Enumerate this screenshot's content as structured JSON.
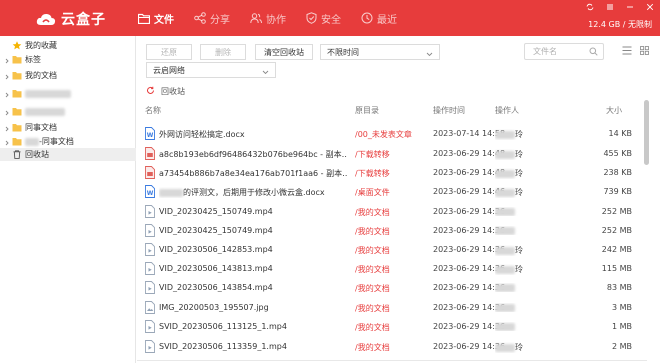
{
  "app": {
    "name": "云盒子"
  },
  "nav": [
    {
      "label": "文件",
      "icon": "folder-icon",
      "active": true
    },
    {
      "label": "分享",
      "icon": "share-icon",
      "active": false
    },
    {
      "label": "协作",
      "icon": "team-icon",
      "active": false
    },
    {
      "label": "安全",
      "icon": "shield-icon",
      "active": false
    },
    {
      "label": "最近",
      "icon": "clock-icon",
      "active": false
    }
  ],
  "quota": "12.4 GB / 无限制",
  "sidebar": {
    "items": [
      {
        "label": "我的收藏",
        "icon": "star-icon",
        "arrow": false,
        "redacted": false
      },
      {
        "label": "标签",
        "icon": "folder-icon",
        "arrow": true,
        "redacted": false
      },
      {
        "label": "我的文档",
        "icon": "folder-icon",
        "arrow": true,
        "redacted": false
      },
      {
        "label": "",
        "icon": "folder-icon",
        "arrow": true,
        "redacted": true
      },
      {
        "label": "",
        "icon": "folder-icon",
        "arrow": true,
        "redacted": true
      },
      {
        "label": "同事文档",
        "icon": "folder-icon",
        "arrow": true,
        "redacted": false
      },
      {
        "label": "-同事文档",
        "icon": "folder-icon",
        "arrow": true,
        "redacted": true
      },
      {
        "label": "回收站",
        "icon": "trash-icon",
        "arrow": false,
        "redacted": false,
        "selected": true
      }
    ]
  },
  "toolbar": {
    "restore_label": "还原",
    "delete_label": "删除",
    "empty_label": "清空回收站",
    "time_filter": "不限时间",
    "scope_filter": "云启网络",
    "search_placeholder": "文件名"
  },
  "breadcrumb": {
    "label": "回收站"
  },
  "table": {
    "headers": {
      "name": "名称",
      "orig": "原目录",
      "time": "操作时间",
      "op": "操作人",
      "size": "大小"
    },
    "rows": [
      {
        "name": "外网访问轻松搞定.docx",
        "icon": "word-doc-icon",
        "orig": "/00_未发表文章",
        "time": "2023-07-14 14:58",
        "op": "玲",
        "size": "14 KB",
        "nameRedacted": false
      },
      {
        "name": "a8c8b193eb6df96486432b076be964bc - 副本…",
        "icon": "red-file-icon",
        "orig": "/下载转移",
        "time": "2023-06-29 14:48",
        "op": "玲",
        "size": "455 KB",
        "nameRedacted": false
      },
      {
        "name": "a73454b886b7a8e34ea176ab701f1aa6 - 副本…",
        "icon": "red-file-icon",
        "orig": "/下载转移",
        "time": "2023-06-29 14:48",
        "op": "玲",
        "size": "238 KB",
        "nameRedacted": false
      },
      {
        "name": "的评测文，后期用于修改小微云盒.docx",
        "icon": "word-doc-icon",
        "orig": "/桌面文件",
        "time": "2023-06-29 14:46",
        "op": "玲",
        "size": "739 KB",
        "nameRedacted": true
      },
      {
        "name": "VID_20230425_150749.mp4",
        "icon": "video-file-icon",
        "orig": "/我的文档",
        "time": "2023-06-29 14:36",
        "op": "",
        "size": "252 MB",
        "nameRedacted": false
      },
      {
        "name": "VID_20230425_150749.mp4",
        "icon": "video-file-icon",
        "orig": "/我的文档",
        "time": "2023-06-29 14:36",
        "op": "",
        "size": "252 MB",
        "nameRedacted": false
      },
      {
        "name": "VID_20230506_142853.mp4",
        "icon": "video-file-icon",
        "orig": "/我的文档",
        "time": "2023-06-29 14:36",
        "op": "玲",
        "size": "242 MB",
        "nameRedacted": false
      },
      {
        "name": "VID_20230506_143813.mp4",
        "icon": "video-file-icon",
        "orig": "/我的文档",
        "time": "2023-06-29 14:36",
        "op": "玲",
        "size": "115 MB",
        "nameRedacted": false
      },
      {
        "name": "VID_20230506_143854.mp4",
        "icon": "video-file-icon",
        "orig": "/我的文档",
        "time": "2023-06-29 14:36",
        "op": "",
        "size": "83 MB",
        "nameRedacted": false
      },
      {
        "name": "IMG_20200503_195507.jpg",
        "icon": "image-file-icon",
        "orig": "/我的文档",
        "time": "2023-06-29 14:36",
        "op": "",
        "size": "3 MB",
        "nameRedacted": false
      },
      {
        "name": "SVID_20230506_113125_1.mp4",
        "icon": "video-file-icon",
        "orig": "/我的文档",
        "time": "2023-06-29 14:36",
        "op": "",
        "size": "1 MB",
        "nameRedacted": false
      },
      {
        "name": "SVID_20230506_113359_1.mp4",
        "icon": "video-file-icon",
        "orig": "/我的文档",
        "time": "2023-06-29 14:36",
        "op": "玲",
        "size": "2 MB",
        "nameRedacted": false
      }
    ]
  },
  "colors": {
    "brand": "#e73c3c",
    "selected_bg": "#eeeeee"
  }
}
